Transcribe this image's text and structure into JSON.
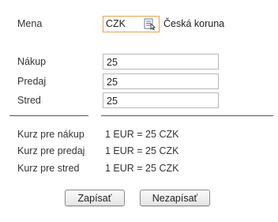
{
  "currency": {
    "label": "Mena",
    "code": "CZK",
    "name": "Česká koruna",
    "icon": "list-lookup-icon"
  },
  "rates": {
    "buy_label": "Nákup",
    "buy_value": "25",
    "sell_label": "Predaj",
    "sell_value": "25",
    "mid_label": "Stred",
    "mid_value": "25"
  },
  "summary": {
    "buy_label": "Kurz pre nákup",
    "buy_value": "1 EUR = 25 CZK",
    "sell_label": "Kurz pre predaj",
    "sell_value": "1 EUR = 25 CZK",
    "mid_label": "Kurz pre stred",
    "mid_value": "1 EUR = 25 CZK"
  },
  "actions": {
    "save_label": "Zapísať",
    "cancel_label": "Nezapísať"
  },
  "colors": {
    "focus_border": "#e8a14a",
    "field_border": "#b8b8b8",
    "text": "#333333"
  }
}
